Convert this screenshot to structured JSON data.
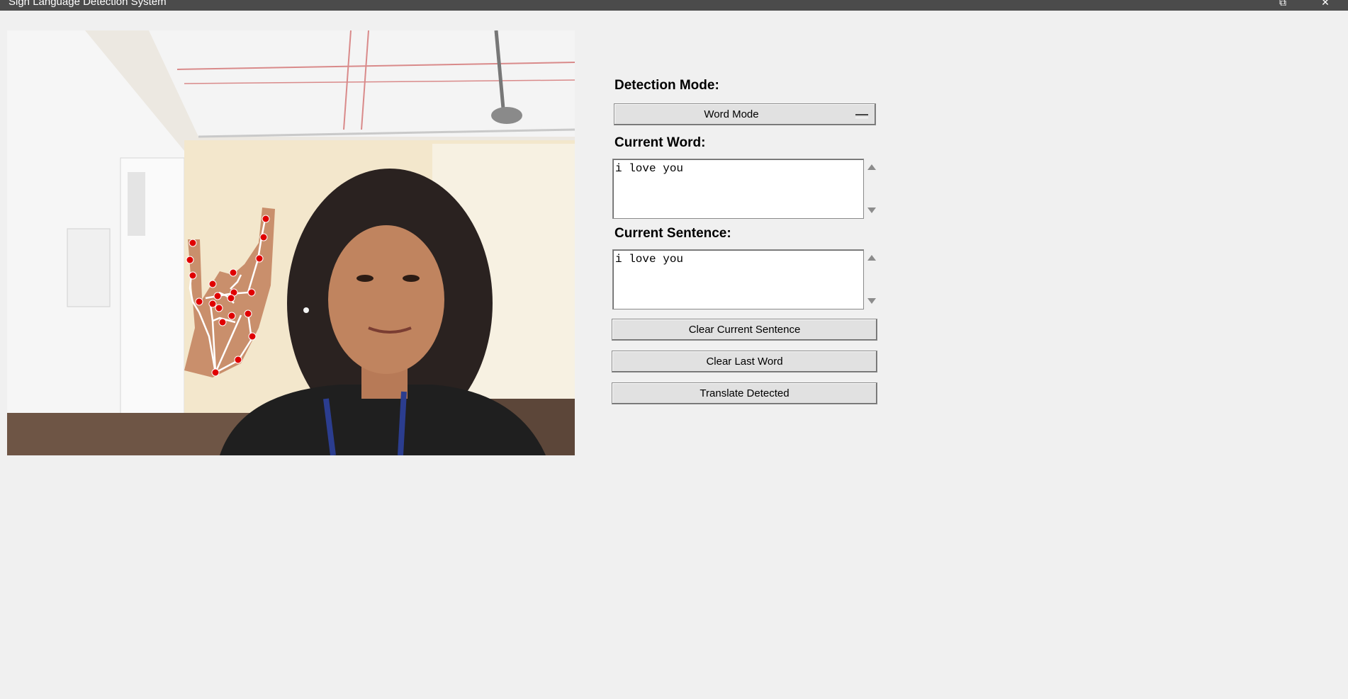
{
  "window": {
    "title": "Sign Language Detection System",
    "restore_glyph": "⧉",
    "close_glyph": "✕"
  },
  "video": {
    "icon": "camera-feed-with-hand-landmarks",
    "landmark_color": "#e00000",
    "skeleton_color": "#ffffff"
  },
  "controls": {
    "detection_mode_label": "Detection Mode:",
    "detection_mode_value": "Word Mode",
    "current_word_label": "Current Word:",
    "current_word_value": "i love you",
    "current_sentence_label": "Current Sentence:",
    "current_sentence_value": "i love you",
    "clear_sentence_label": "Clear Current Sentence",
    "clear_last_word_label": "Clear Last Word",
    "translate_label": "Translate Detected"
  }
}
